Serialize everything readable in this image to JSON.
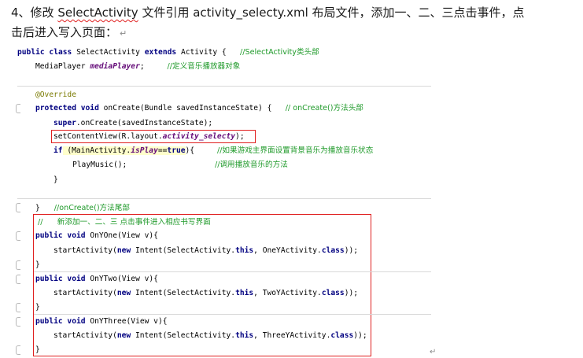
{
  "heading": {
    "prefix": "4、修改 ",
    "class_name": "SelectActivity",
    "middle": " 文件引用 activity_selecty.xml 布局文件，添加一、二、三点击事件，点",
    "line2": "击后进入写入页面：",
    "para_mark": "↵"
  },
  "code": {
    "l1": {
      "kw1": "public class",
      "t1": " SelectActivity ",
      "kw2": "extends",
      "t2": " Activity {   ",
      "cm": "//SelectActivity类头部"
    },
    "l2": {
      "t1": "MediaPlayer ",
      "fld": "mediaPlayer",
      "t2": ";     ",
      "cm": "//定义音乐播放器对象"
    },
    "l3": {
      "ann": "@Override"
    },
    "l4": {
      "kw1": "protected void",
      "t1": " onCreate(Bundle savedInstanceState) {   ",
      "cm": "// onCreate()方法头部"
    },
    "l5": {
      "kw": "super",
      "t": ".onCreate(savedInstanceState);"
    },
    "l6": {
      "t1": "setContentView(R.layout.",
      "fld": "activity_selecty",
      "t2": ");"
    },
    "l7": {
      "kw": "if",
      "t1": " (MainActivity.",
      "fld": "isPlay",
      "t2": "==",
      "kw2": "true",
      "t3": "){     ",
      "cm": "//如果游戏主界面设置背景音乐为播放音乐状态"
    },
    "l8": {
      "t": "PlayMusic();",
      "cm": "//调用播放音乐的方法"
    },
    "l9": {
      "t": "}"
    },
    "l10": {
      "t": "}",
      "cm": "//onCreate()方法尾部"
    },
    "l11": {
      "cm": "//      新添加一、二、三 点击事件进入相应书写界面"
    },
    "l12": {
      "kw": "public void",
      "t": " OnYOne(View v){"
    },
    "l13": {
      "t1": "startActivity(",
      "kw1": "new",
      "t2": " Intent(SelectActivity.",
      "kw2": "this",
      "t3": ", OneYActivity.",
      "kw3": "class",
      "t4": "));"
    },
    "l14": {
      "t": "}"
    },
    "l15": {
      "kw": "public void",
      "t": " OnYTwo(View v){"
    },
    "l16": {
      "t1": "startActivity(",
      "kw1": "new",
      "t2": " Intent(SelectActivity.",
      "kw2": "this",
      "t3": ", TwoYActivity.",
      "kw3": "class",
      "t4": "));"
    },
    "l17": {
      "t": "}"
    },
    "l18": {
      "kw": "public void",
      "t": " OnYThree(View v){"
    },
    "l19": {
      "t1": "startActivity(",
      "kw1": "new",
      "t2": " Intent(SelectActivity.",
      "kw2": "this",
      "t3": ", ThreeYActivity.",
      "kw3": "class",
      "t4": "));"
    },
    "l20": {
      "t": "}"
    }
  }
}
